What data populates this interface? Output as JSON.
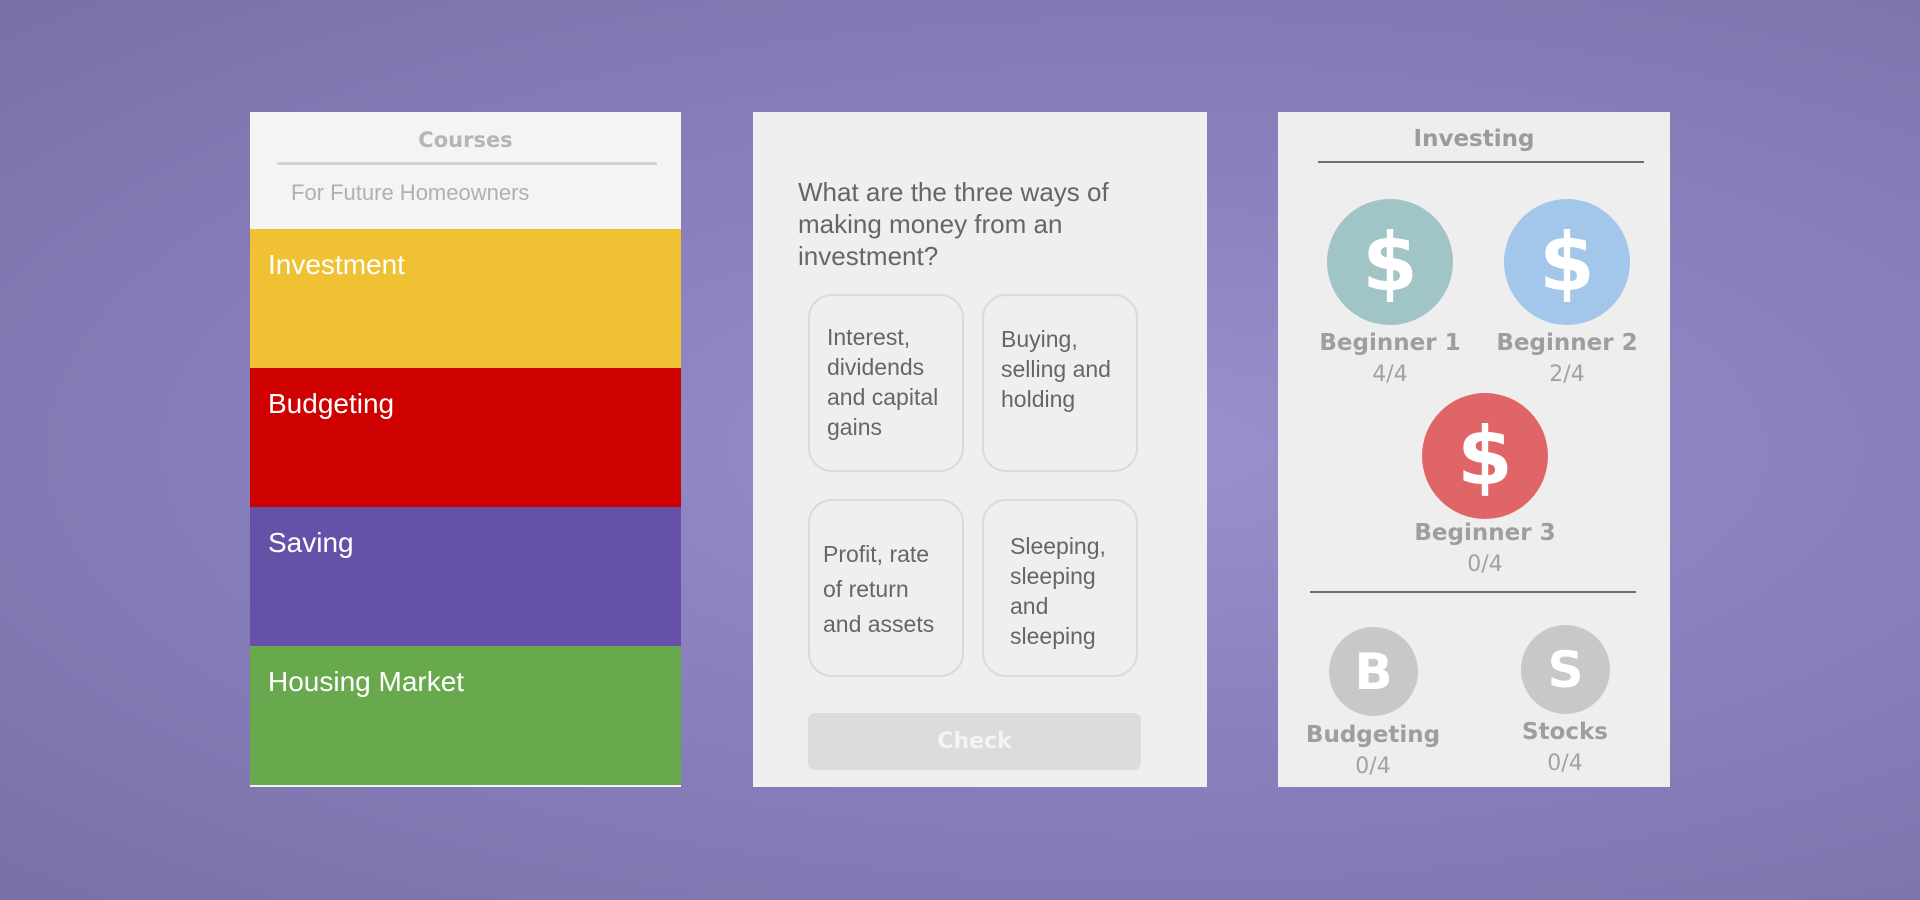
{
  "courses_panel": {
    "title": "Courses",
    "subtitle": "For Future Homeowners",
    "items": [
      {
        "label": "Investment",
        "color": "#f0c233"
      },
      {
        "label": "Budgeting",
        "color": "#cf0000"
      },
      {
        "label": "Saving",
        "color": "#6651a9"
      },
      {
        "label": "Housing Market",
        "color": "#69a94e"
      }
    ]
  },
  "quiz": {
    "question": "What are the three ways of making money from an investment?",
    "answers": [
      "Interest, dividends and capital gains",
      "Buying, selling and holding",
      "Profit, rate of return and assets",
      "Sleeping, sleeping and sleeping"
    ],
    "check_label": "Check"
  },
  "investing_panel": {
    "title": "Investing",
    "levels": [
      {
        "name": "Beginner 1",
        "progress": "4/4",
        "icon": "dollar-icon",
        "color": "#a1c4c7",
        "glyph": "$"
      },
      {
        "name": "Beginner 2",
        "progress": "2/4",
        "icon": "dollar-icon",
        "color": "#a2c7ea",
        "glyph": "$"
      },
      {
        "name": "Beginner 3",
        "progress": "0/4",
        "icon": "dollar-icon",
        "color": "#e06566",
        "glyph": "$"
      }
    ],
    "other_courses": [
      {
        "name": "Budgeting",
        "progress": "0/4",
        "letter": "B",
        "color": "#c8c8c8"
      },
      {
        "name": "Stocks",
        "progress": "0/4",
        "letter": "S",
        "color": "#c8c8c8"
      }
    ]
  }
}
